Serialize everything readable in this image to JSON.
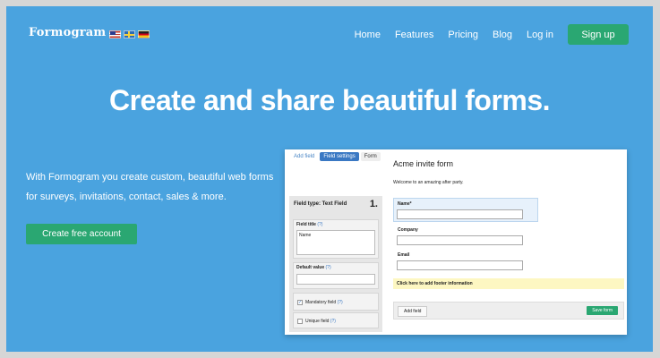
{
  "brand": {
    "logo": "Formogram"
  },
  "flags": [
    "us-flag-icon",
    "se-flag-icon",
    "de-flag-icon"
  ],
  "nav": {
    "home": "Home",
    "features": "Features",
    "pricing": "Pricing",
    "blog": "Blog",
    "login": "Log in",
    "signup": "Sign up"
  },
  "hero": {
    "headline": "Create and share beautiful forms.",
    "intro": "With Formogram you create custom, beautiful web forms for surveys, invitations, contact, sales & more.",
    "cta": "Create free account"
  },
  "app": {
    "tabs": {
      "add_field": "Add field",
      "field_settings": "Field settings",
      "form": "Form"
    },
    "field_type": "Field type: Text Field",
    "field_number": "1.",
    "field_title_label": "Field title",
    "field_title_value": "Name",
    "default_value_label": "Default value",
    "help": "(?)",
    "mandatory_label": "Mandatory field",
    "unique_label": "Unique field",
    "form_title": "Acme invite form",
    "welcome": "Welcome to an amazing after party.",
    "fields": {
      "name": "Name*",
      "company": "Company",
      "email": "Email"
    },
    "footer_text": "Click here to add footer information",
    "add_field_button": "Add field",
    "save_form_button": "Save form"
  },
  "colors": {
    "background": "#4aa3df",
    "accent_green": "#2aa772",
    "tab_blue": "#3a78c3"
  }
}
